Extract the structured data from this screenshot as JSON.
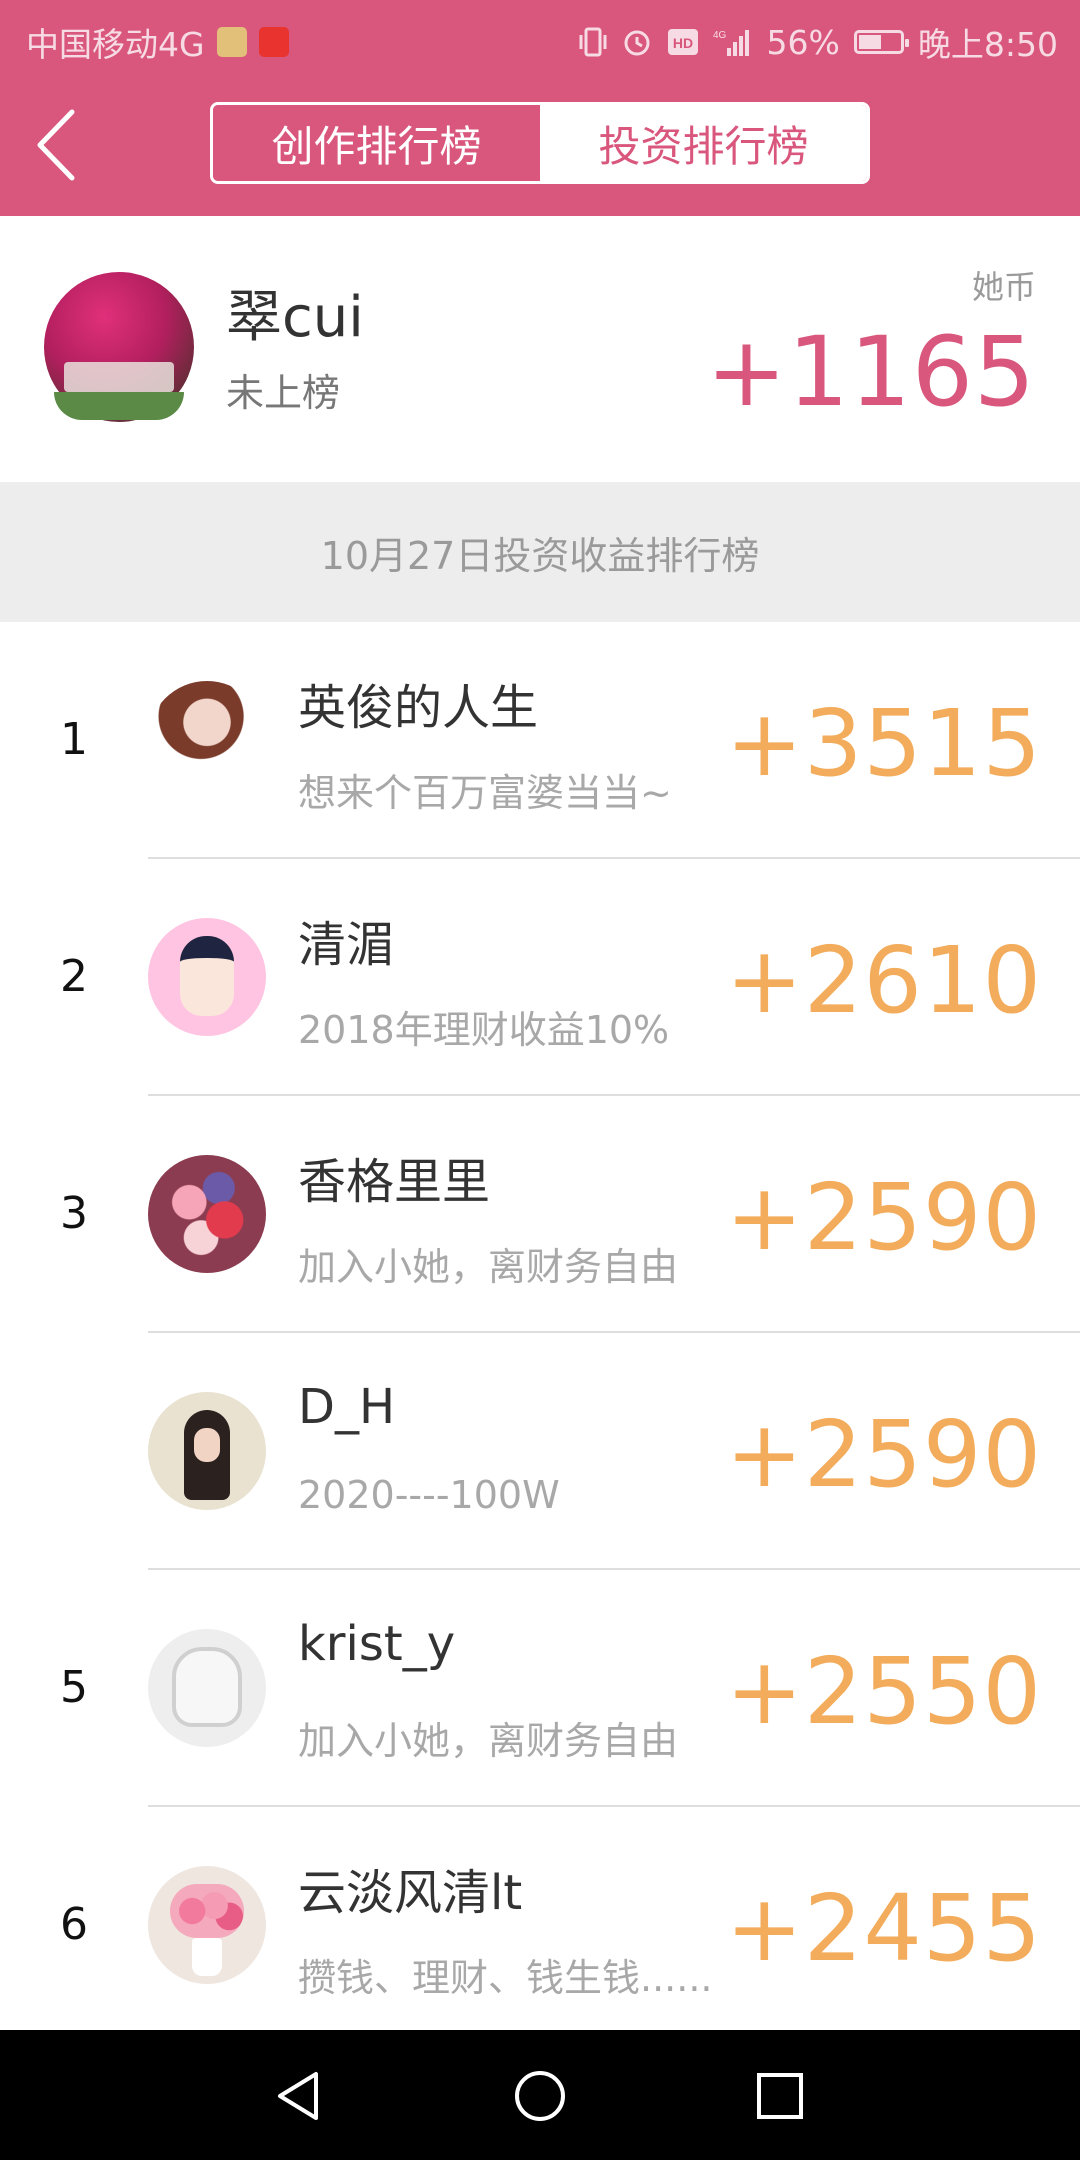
{
  "status_bar": {
    "carrier": "中国移动4G",
    "battery_percent": "56%",
    "time": "晚上8:50",
    "battery_level": 0.56,
    "icons": [
      "vibrate-icon",
      "alarm-icon",
      "hd-icon",
      "signal-icon",
      "battery-icon"
    ]
  },
  "header": {
    "tabs": [
      {
        "label": "创作排行榜",
        "active": true
      },
      {
        "label": "投资排行榜",
        "active": false
      }
    ],
    "accent_color": "#d9577d"
  },
  "my_card": {
    "name": "翠cui",
    "status": "未上榜",
    "coin_label": "她币",
    "coin_value": "+1165"
  },
  "banner": {
    "text": "10月27日投资收益排行榜"
  },
  "ranking": [
    {
      "rank": "1",
      "name": "英俊的人生",
      "bio": "想来个百万富婆当当~",
      "score": "+3515"
    },
    {
      "rank": "2",
      "name": "清湄",
      "bio": "2018年理财收益10%",
      "score": "+2610"
    },
    {
      "rank": "3",
      "name": "香格里里",
      "bio": "加入小她，离财务自由",
      "score": "+2590"
    },
    {
      "rank": "",
      "name": "D_H",
      "bio": "2020----100W",
      "score": "+2590"
    },
    {
      "rank": "5",
      "name": "krist_y",
      "bio": "加入小她，离财务自由",
      "score": "+2550"
    },
    {
      "rank": "6",
      "name": "云淡风清lt",
      "bio": "攒钱、理财、钱生钱......",
      "score": "+2455"
    }
  ],
  "score_color": "#f2ac5b"
}
